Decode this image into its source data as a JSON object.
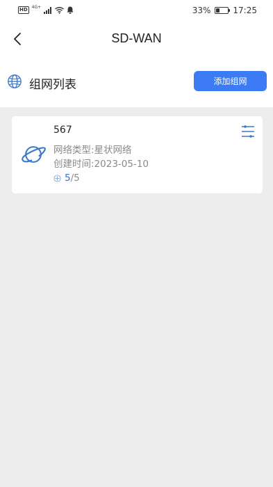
{
  "status_bar": {
    "hd": "HD",
    "network": "4G+",
    "battery_percent": "33%",
    "battery_level": 0.33,
    "time": "17:25"
  },
  "nav": {
    "title": "SD-WAN"
  },
  "section": {
    "title": "组网列表",
    "add_button": "添加组网"
  },
  "networks": [
    {
      "name": "567",
      "type": "网络类型:星状网络",
      "created": "创建时间:2023-05-10",
      "online": "5",
      "separator": "/",
      "total": "5"
    }
  ],
  "colors": {
    "accent": "#3d7bf5",
    "online": "#2f6fdc",
    "icon": "#3a78c9"
  },
  "icons": {
    "back": "chevron-left-icon",
    "section": "globe-icon",
    "card": "planet-icon",
    "filter": "settings-sliders-icon"
  }
}
